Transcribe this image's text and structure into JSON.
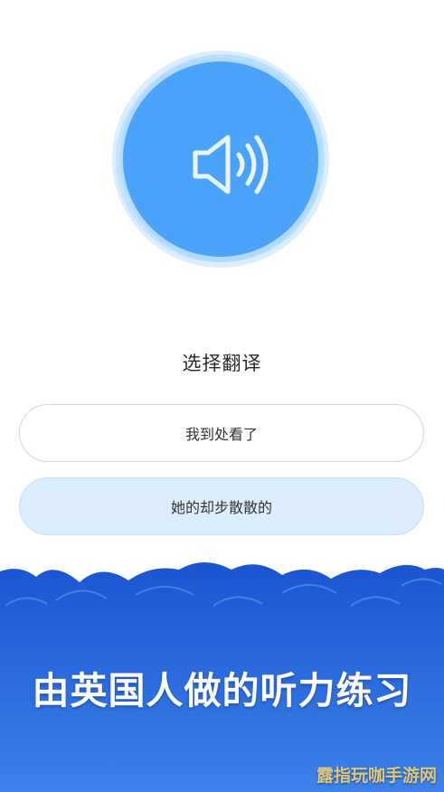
{
  "speaker": {
    "icon": "speaker-volume-icon"
  },
  "question": {
    "prompt": "选择翻译"
  },
  "options": [
    {
      "label": "我到处看了"
    },
    {
      "label": "她的却步散散的"
    }
  ],
  "promo": {
    "tagline": "由英国人做的听力练习"
  },
  "watermark": {
    "text": "露指玩咖手游网"
  },
  "colors": {
    "accent": "#4aa3f8",
    "selected_option_bg": "#dcedfd",
    "footer_top": "#1a55d0",
    "footer_bottom": "#3d82ea"
  }
}
